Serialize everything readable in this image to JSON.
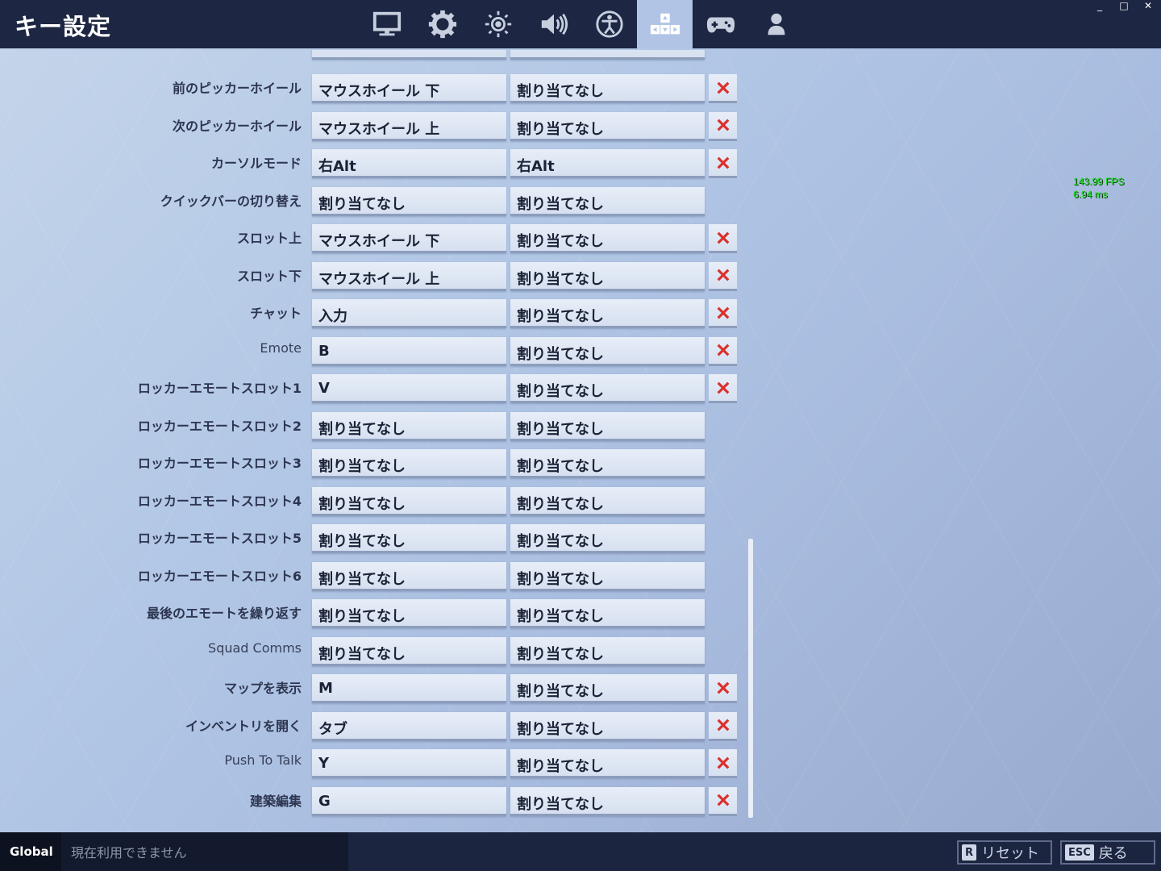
{
  "header": {
    "title": "キー設定",
    "tabs": [
      {
        "icon": "monitor-icon",
        "active": false
      },
      {
        "icon": "gear-icon",
        "active": false
      },
      {
        "icon": "brightness-icon",
        "active": false
      },
      {
        "icon": "speaker-icon",
        "active": false
      },
      {
        "icon": "accessibility-icon",
        "active": false
      },
      {
        "icon": "keys-icon",
        "active": true
      },
      {
        "icon": "gamepad-icon",
        "active": false
      },
      {
        "icon": "account-icon",
        "active": false
      }
    ],
    "window_controls": [
      "_",
      "□",
      "✕"
    ]
  },
  "overlay": {
    "fps": "143.99 FPS",
    "ms": "6.94 ms"
  },
  "bindings": [
    {
      "label": "前のピッカーホイール",
      "primary": "マウスホイール 下",
      "secondary": "割り当てなし",
      "clear": true
    },
    {
      "label": "次のピッカーホイール",
      "primary": "マウスホイール 上",
      "secondary": "割り当てなし",
      "clear": true
    },
    {
      "label": "カーソルモード",
      "primary": "右Alt",
      "secondary": "右Alt",
      "clear": true
    },
    {
      "label": "クイックバーの切り替え",
      "primary": "割り当てなし",
      "secondary": "割り当てなし",
      "clear": false
    },
    {
      "label": "スロット上",
      "primary": "マウスホイール 下",
      "secondary": "割り当てなし",
      "clear": true
    },
    {
      "label": "スロット下",
      "primary": "マウスホイール 上",
      "secondary": "割り当てなし",
      "clear": true
    },
    {
      "label": "チャット",
      "primary": "入力",
      "secondary": "割り当てなし",
      "clear": true
    },
    {
      "label": "Emote",
      "primary": "B",
      "secondary": "割り当てなし",
      "clear": true
    },
    {
      "label": "ロッカーエモートスロット1",
      "primary": "V",
      "secondary": "割り当てなし",
      "clear": true
    },
    {
      "label": "ロッカーエモートスロット2",
      "primary": "割り当てなし",
      "secondary": "割り当てなし",
      "clear": false
    },
    {
      "label": "ロッカーエモートスロット3",
      "primary": "割り当てなし",
      "secondary": "割り当てなし",
      "clear": false
    },
    {
      "label": "ロッカーエモートスロット4",
      "primary": "割り当てなし",
      "secondary": "割り当てなし",
      "clear": false
    },
    {
      "label": "ロッカーエモートスロット5",
      "primary": "割り当てなし",
      "secondary": "割り当てなし",
      "clear": false
    },
    {
      "label": "ロッカーエモートスロット6",
      "primary": "割り当てなし",
      "secondary": "割り当てなし",
      "clear": false
    },
    {
      "label": "最後のエモートを繰り返す",
      "primary": "割り当てなし",
      "secondary": "割り当てなし",
      "clear": false
    },
    {
      "label": "Squad Comms",
      "primary": "割り当てなし",
      "secondary": "割り当てなし",
      "clear": false
    },
    {
      "label": "マップを表示",
      "primary": "M",
      "secondary": "割り当てなし",
      "clear": true
    },
    {
      "label": "インベントリを開く",
      "primary": "タブ",
      "secondary": "割り当てなし",
      "clear": true
    },
    {
      "label": "Push To Talk",
      "primary": "Y",
      "secondary": "割り当てなし",
      "clear": true
    },
    {
      "label": "建築編集",
      "primary": "G",
      "secondary": "割り当てなし",
      "clear": true
    }
  ],
  "footer": {
    "scope": "Global",
    "status": "現在利用できません",
    "reset_key": "R",
    "reset_label": "リセット",
    "back_key": "ESC",
    "back_label": "戻る"
  },
  "colors": {
    "accent_tab": "#b1c4e6",
    "clear_x": "#d9302c",
    "fps": "#1fdc1f"
  }
}
